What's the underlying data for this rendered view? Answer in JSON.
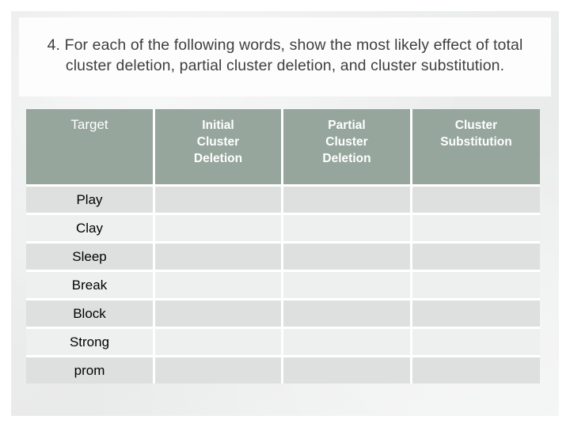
{
  "slide": {
    "title": "4. For each of the following words, show the most likely effect of total cluster deletion, partial cluster deletion, and cluster substitution."
  },
  "colors": {
    "header_fill": "#96a69d",
    "header_text": "#ffffff",
    "row_dark": "#dee0e0",
    "row_light": "#eeefef",
    "title_text": "#3f3f3f",
    "card_background": "#fdfdfd",
    "slide_background": "#eceded"
  },
  "table": {
    "headers": [
      {
        "label": "Target",
        "bold": false
      },
      {
        "label": "Initial\nCluster\nDeletion",
        "bold": true
      },
      {
        "label": "Partial\nCluster\nDeletion",
        "bold": true
      },
      {
        "label": "Cluster\nSubstitution",
        "bold": true
      }
    ],
    "rows": [
      {
        "target": "Play",
        "initial_cluster_deletion": "",
        "partial_cluster_deletion": "",
        "cluster_substitution": ""
      },
      {
        "target": "Clay",
        "initial_cluster_deletion": "",
        "partial_cluster_deletion": "",
        "cluster_substitution": ""
      },
      {
        "target": "Sleep",
        "initial_cluster_deletion": "",
        "partial_cluster_deletion": "",
        "cluster_substitution": ""
      },
      {
        "target": "Break",
        "initial_cluster_deletion": "",
        "partial_cluster_deletion": "",
        "cluster_substitution": ""
      },
      {
        "target": "Block",
        "initial_cluster_deletion": "",
        "partial_cluster_deletion": "",
        "cluster_substitution": ""
      },
      {
        "target": "Strong",
        "initial_cluster_deletion": "",
        "partial_cluster_deletion": "",
        "cluster_substitution": ""
      },
      {
        "target": "prom",
        "initial_cluster_deletion": "",
        "partial_cluster_deletion": "",
        "cluster_substitution": ""
      }
    ]
  }
}
